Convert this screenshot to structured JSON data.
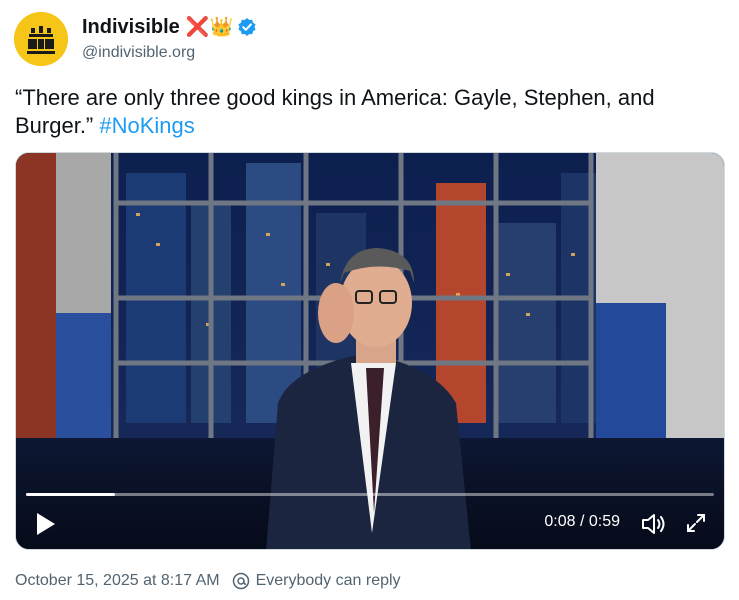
{
  "account": {
    "display_name": "Indivisible",
    "name_emoji": "❌👑",
    "handle": "@indivisible.org",
    "avatar_icon": "indivisible-logo",
    "avatar_color": "#f5c518",
    "verified_icon": "verified-badge-icon"
  },
  "tweet": {
    "text_before": "“There are only three good kings in America: Gayle, Stephen, and Burger.” ",
    "hashtag": "#NoKings"
  },
  "video": {
    "time_display": "0:08 / 0:59",
    "progress": 0.13,
    "play_icon": "play-icon",
    "volume_icon": "volume-icon",
    "fullscreen_icon": "fullscreen-icon"
  },
  "footer": {
    "timestamp": "October 15, 2025 at 8:17 AM",
    "reply_setting": "Everybody can reply",
    "reply_icon": "at-reply-icon"
  },
  "colors": {
    "link": "#1d9bf0",
    "secondary_text": "#536471",
    "primary_text": "#0f1419",
    "verified": "#1d9bf0"
  }
}
